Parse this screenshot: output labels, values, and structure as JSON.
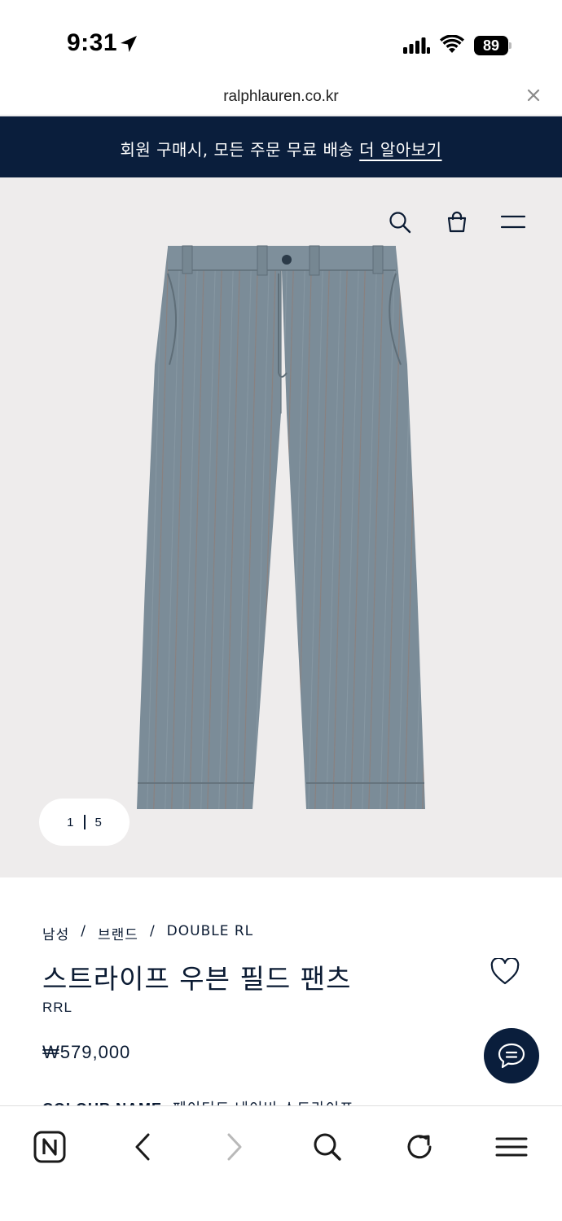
{
  "status_bar": {
    "time": "9:31",
    "battery": "89"
  },
  "browser": {
    "url": "ralphlauren.co.kr"
  },
  "promo": {
    "text": "회원 구매시, 모든 주문 무료 배송",
    "link": "더 알아보기",
    "background": "#0a1e3c"
  },
  "header_icons": [
    "search-icon",
    "shopping-bag-icon",
    "menu-icon"
  ],
  "gallery": {
    "current": "1",
    "total": "5"
  },
  "product": {
    "breadcrumb": [
      "남성",
      "브랜드",
      "DOUBLE RL"
    ],
    "breadcrumb_separator": "/",
    "title": "스트라이프 우븐 필드 팬츠",
    "brand": "RRL",
    "price": "₩579,000",
    "colour_label": "COLOUR NAME:",
    "colour_value": "페이디드 네이비 스트라이프"
  },
  "toolbar": {
    "items": [
      "home-n-icon",
      "back-icon",
      "forward-icon",
      "search-icon",
      "reload-icon",
      "menu-icon"
    ]
  }
}
